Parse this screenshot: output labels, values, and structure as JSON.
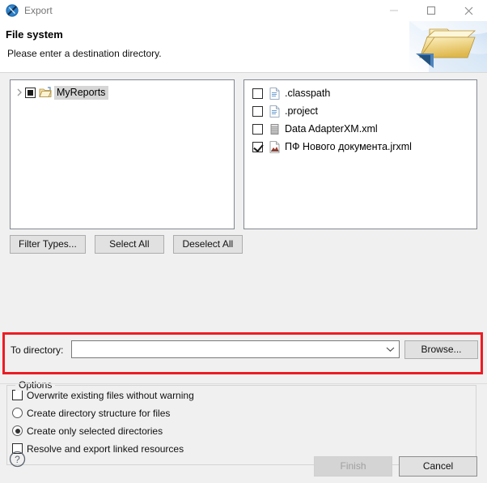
{
  "window": {
    "title": "Export",
    "app_icon": "jasper-studio-icon",
    "controls": {
      "minimize": "minimize-icon",
      "maximize": "maximize-icon",
      "close": "close-icon"
    }
  },
  "header": {
    "title": "File system",
    "description": "Please enter a destination directory.",
    "banner_icon": "export-folder-icon"
  },
  "tree": {
    "items": [
      {
        "label": "MyReports",
        "icon": "folder-icon",
        "check_state": "partial",
        "expander": "chevron-right-icon",
        "selected": true
      }
    ]
  },
  "files": {
    "items": [
      {
        "label": ".classpath",
        "icon": "file-xml-icon",
        "checked": false
      },
      {
        "label": ".project",
        "icon": "file-xml-icon",
        "checked": false
      },
      {
        "label": "Data AdapterXM.xml",
        "icon": "data-adapter-icon",
        "checked": false
      },
      {
        "label": "ПФ Нового документа.jrxml",
        "icon": "jrxml-report-icon",
        "checked": true
      }
    ]
  },
  "buttons": {
    "filter_types": "Filter Types...",
    "select_all": "Select All",
    "deselect_all": "Deselect All",
    "browse": "Browse..."
  },
  "to_directory": {
    "label": "To directory:",
    "value": "",
    "placeholder": "",
    "dropdown_icon": "chevron-down-icon",
    "highlight_color": "#ec1c24"
  },
  "options": {
    "group_title": "Options",
    "items": [
      {
        "type": "checkbox",
        "label": "Overwrite existing files without warning",
        "checked": false
      },
      {
        "type": "radio",
        "label": "Create directory structure for files",
        "checked": false
      },
      {
        "type": "radio",
        "label": "Create only selected directories",
        "checked": true
      },
      {
        "type": "checkbox",
        "label": "Resolve and export linked resources",
        "checked": false
      }
    ]
  },
  "footer": {
    "help_icon": "help-question-icon",
    "finish_label": "Finish",
    "finish_enabled": false,
    "cancel_label": "Cancel",
    "cancel_enabled": true
  }
}
